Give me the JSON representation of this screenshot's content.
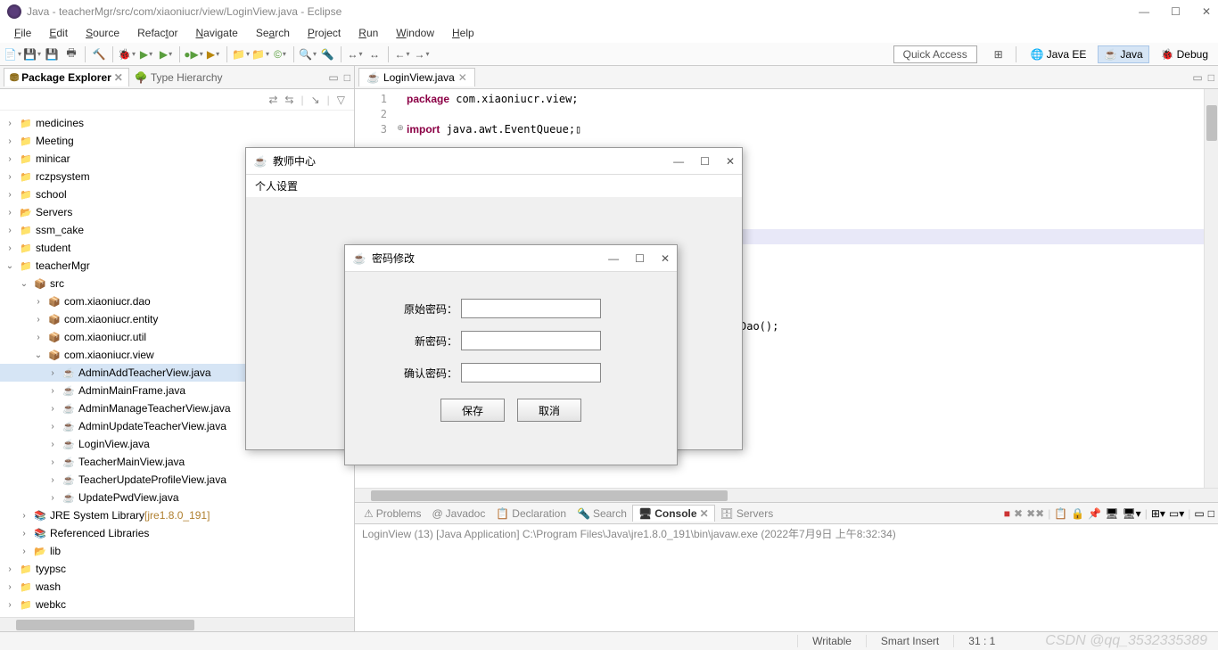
{
  "title": "Java - teacherMgr/src/com/xiaoniucr/view/LoginView.java - Eclipse",
  "menus": [
    "File",
    "Edit",
    "Source",
    "Refactor",
    "Navigate",
    "Search",
    "Project",
    "Run",
    "Window",
    "Help"
  ],
  "quick_access": "Quick Access",
  "perspectives": {
    "java_ee": "Java EE",
    "java": "Java",
    "debug": "Debug"
  },
  "sidebar": {
    "tab_active": "Package Explorer",
    "tab_inactive": "Type Hierarchy",
    "tree": [
      {
        "d": 0,
        "tw": ">",
        "ic": "proj",
        "label": "medicines"
      },
      {
        "d": 0,
        "tw": ">",
        "ic": "proj",
        "label": "Meeting"
      },
      {
        "d": 0,
        "tw": ">",
        "ic": "proj",
        "label": "minicar"
      },
      {
        "d": 0,
        "tw": ">",
        "ic": "proj",
        "label": "rczpsystem"
      },
      {
        "d": 0,
        "tw": ">",
        "ic": "proj",
        "label": "school"
      },
      {
        "d": 0,
        "tw": ">",
        "ic": "folder",
        "label": "Servers"
      },
      {
        "d": 0,
        "tw": ">",
        "ic": "proj",
        "label": "ssm_cake"
      },
      {
        "d": 0,
        "tw": ">",
        "ic": "proj",
        "label": "student"
      },
      {
        "d": 0,
        "tw": "v",
        "ic": "proj",
        "label": "teacherMgr"
      },
      {
        "d": 1,
        "tw": "v",
        "ic": "pkg2",
        "label": "src"
      },
      {
        "d": 2,
        "tw": ">",
        "ic": "pkg2",
        "label": "com.xiaoniucr.dao"
      },
      {
        "d": 2,
        "tw": ">",
        "ic": "pkg2",
        "label": "com.xiaoniucr.entity"
      },
      {
        "d": 2,
        "tw": ">",
        "ic": "pkg2",
        "label": "com.xiaoniucr.util"
      },
      {
        "d": 2,
        "tw": "v",
        "ic": "pkg2",
        "label": "com.xiaoniucr.view"
      },
      {
        "d": 3,
        "tw": ">",
        "ic": "java",
        "label": "AdminAddTeacherView.java",
        "sel": true
      },
      {
        "d": 3,
        "tw": ">",
        "ic": "java",
        "label": "AdminMainFrame.java"
      },
      {
        "d": 3,
        "tw": ">",
        "ic": "java",
        "label": "AdminManageTeacherView.java"
      },
      {
        "d": 3,
        "tw": ">",
        "ic": "java",
        "label": "AdminUpdateTeacherView.java"
      },
      {
        "d": 3,
        "tw": ">",
        "ic": "java",
        "label": "LoginView.java"
      },
      {
        "d": 3,
        "tw": ">",
        "ic": "java",
        "label": "TeacherMainView.java"
      },
      {
        "d": 3,
        "tw": ">",
        "ic": "java",
        "label": "TeacherUpdateProfileView.java"
      },
      {
        "d": 3,
        "tw": ">",
        "ic": "java",
        "label": "UpdatePwdView.java"
      },
      {
        "d": 1,
        "tw": ">",
        "ic": "lib",
        "label": "JRE System Library",
        "suffix": "[jre1.8.0_191]"
      },
      {
        "d": 1,
        "tw": ">",
        "ic": "lib",
        "label": "Referenced Libraries"
      },
      {
        "d": 1,
        "tw": ">",
        "ic": "folder",
        "label": "lib"
      },
      {
        "d": 0,
        "tw": ">",
        "ic": "proj",
        "label": "tyypsc"
      },
      {
        "d": 0,
        "tw": ">",
        "ic": "proj",
        "label": "wash"
      },
      {
        "d": 0,
        "tw": ">",
        "ic": "proj",
        "label": "webkc"
      }
    ]
  },
  "editor": {
    "tab": "LoginView.java",
    "lines": [
      {
        "n": "1",
        "fold": "",
        "html": "<span class='kw'>package</span> com.xiaoniucr.view;"
      },
      {
        "n": "2",
        "fold": "",
        "html": ""
      },
      {
        "n": "3",
        "fold": "⊕",
        "html": "<span class='kw'>import</span> java.awt.EventQueue;▯"
      }
    ],
    "frag": "Dao();"
  },
  "bottom": {
    "tabs": {
      "problems": "Problems",
      "javadoc": "Javadoc",
      "declaration": "Declaration",
      "search": "Search",
      "console": "Console",
      "servers": "Servers"
    },
    "console_hdr": "LoginView (13) [Java Application] C:\\Program Files\\Java\\jre1.8.0_191\\bin\\javaw.exe (2022年7月9日 上午8:32:34)"
  },
  "status": {
    "writable": "Writable",
    "insert": "Smart Insert",
    "pos": "31 : 1"
  },
  "watermark": "CSDN @qq_3532335389",
  "dlg1": {
    "title": "教师中心",
    "menu": "个人设置"
  },
  "dlg2": {
    "title": "密码修改",
    "f1": "原始密码：",
    "f2": "新密码：",
    "f3": "确认密码：",
    "save": "保存",
    "cancel": "取消"
  }
}
